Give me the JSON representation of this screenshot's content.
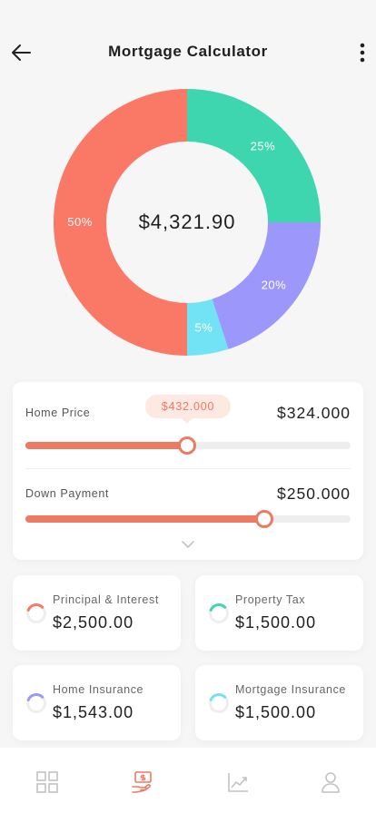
{
  "header": {
    "title": "Mortgage Calculator"
  },
  "chart_data": {
    "type": "pie",
    "center_label": "$4,321.90",
    "slices": [
      {
        "label": "25%",
        "value": 25,
        "color": "#3dd6ae"
      },
      {
        "label": "20%",
        "value": 20,
        "color": "#9b97fb"
      },
      {
        "label": "5%",
        "value": 5,
        "color": "#72e3f5"
      },
      {
        "label": "50%",
        "value": 50,
        "color": "#fa7866"
      }
    ]
  },
  "sliders": {
    "home_price": {
      "label": "Home Price",
      "value": "$324.000",
      "tooltip": "$432.000",
      "fraction": 0.498
    },
    "down_payment": {
      "label": "Down Payment",
      "value": "$250.000",
      "fraction": 0.735
    }
  },
  "stats": [
    {
      "label": "Principal & Interest",
      "value": "$2,500.00",
      "color": "#fa7866"
    },
    {
      "label": "Property Tax",
      "value": "$1,500.00",
      "color": "#3dd6ae"
    },
    {
      "label": "Home Insurance",
      "value": "$1,543.00",
      "color": "#9b97fb"
    },
    {
      "label": "Mortgage Insurance",
      "value": "$1,500.00",
      "color": "#72e3f5"
    }
  ],
  "tabs": [
    {
      "icon": "grid-icon",
      "active": false
    },
    {
      "icon": "money-hand-icon",
      "active": true
    },
    {
      "icon": "chart-line-icon",
      "active": false
    },
    {
      "icon": "user-icon",
      "active": false
    }
  ],
  "colors": {
    "accent": "#ee7a63",
    "inactive_icon": "#c2c2c2"
  }
}
